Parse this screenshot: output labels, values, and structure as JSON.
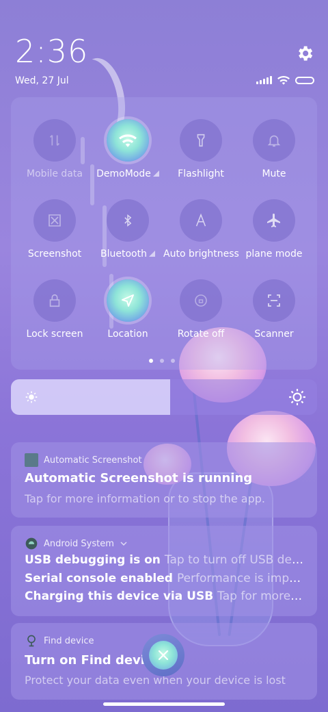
{
  "status_bar": {
    "time": "2:36",
    "date": "Wed, 27 Jul",
    "icons": [
      "signal-icon",
      "wifi-icon",
      "battery-icon"
    ]
  },
  "settings_icon": "gear-icon",
  "quick_settings": {
    "tiles": [
      {
        "id": "mobile-data",
        "label": "Mobile data",
        "icon": "mobile-data-icon",
        "active": false,
        "dim": true
      },
      {
        "id": "demo-mode",
        "label": "DemoMode",
        "icon": "wifi-icon",
        "active": true,
        "dim": false,
        "has_arrow": true
      },
      {
        "id": "flashlight",
        "label": "Flashlight",
        "icon": "flashlight-icon",
        "active": false,
        "dim": false
      },
      {
        "id": "mute",
        "label": "Mute",
        "icon": "bell-icon",
        "active": false,
        "dim": false
      },
      {
        "id": "screenshot",
        "label": "Screenshot",
        "icon": "screenshot-icon",
        "active": false,
        "dim": false
      },
      {
        "id": "bluetooth",
        "label": "Bluetooth",
        "icon": "bluetooth-icon",
        "active": false,
        "dim": false,
        "has_arrow": true
      },
      {
        "id": "auto-brightness",
        "label": "Auto brightness",
        "icon": "auto-brightness-icon",
        "active": false,
        "dim": false
      },
      {
        "id": "airplane-mode",
        "label": "plane mode",
        "icon": "airplane-icon",
        "active": false,
        "dim": false
      },
      {
        "id": "lock-screen",
        "label": "Lock screen",
        "icon": "lock-icon",
        "active": false,
        "dim": false
      },
      {
        "id": "location",
        "label": "Location",
        "icon": "location-icon",
        "active": true,
        "dim": false
      },
      {
        "id": "rotate-off",
        "label": "Rotate off",
        "icon": "rotate-lock-icon",
        "active": false,
        "dim": false
      },
      {
        "id": "scanner",
        "label": "Scanner",
        "icon": "scanner-icon",
        "active": false,
        "dim": false
      }
    ],
    "page_indicator": {
      "pages": 3,
      "current": 1
    }
  },
  "brightness": {
    "level": 0.52
  },
  "notifications": {
    "auto_screenshot": {
      "app": "Automatic Screenshot",
      "title": "Automatic Screenshot is running",
      "body": "Tap for more information or to stop the app."
    },
    "android_system": {
      "app": "Android System",
      "lines": [
        {
          "title": "USB debugging is on",
          "text": "Tap to turn off USB debug…"
        },
        {
          "title": "Serial console enabled",
          "text": "Performance is impact…"
        },
        {
          "title": "Charging this device via USB",
          "text": "Tap for more opt…"
        }
      ]
    },
    "find_device": {
      "app": "Find device",
      "title": "Turn on Find device",
      "body": "Protect your data even when your device is lost"
    }
  },
  "dismiss_all_icon": "close-icon"
}
